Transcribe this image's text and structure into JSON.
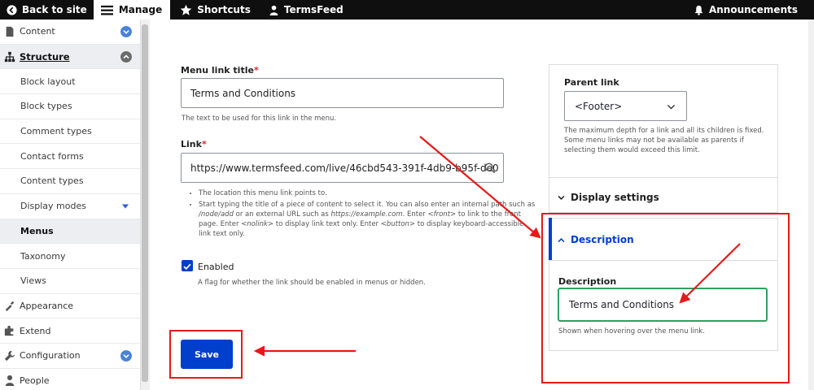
{
  "toolbar": {
    "back": "Back to site",
    "manage": "Manage",
    "shortcuts": "Shortcuts",
    "user": "TermsFeed",
    "announcements": "Announcements"
  },
  "sidebar": {
    "content": "Content",
    "structure": "Structure",
    "sub": {
      "block_layout": "Block layout",
      "block_types": "Block types",
      "comment_types": "Comment types",
      "contact_forms": "Contact forms",
      "content_types": "Content types",
      "display_modes": "Display modes",
      "menus": "Menus",
      "taxonomy": "Taxonomy",
      "views": "Views"
    },
    "appearance": "Appearance",
    "extend": "Extend",
    "configuration": "Configuration",
    "people": "People"
  },
  "form": {
    "menu_link_title_label": "Menu link title",
    "required_mark": "*",
    "menu_link_title_value": "Terms and Conditions",
    "menu_link_title_desc": "The text to be used for this link in the menu.",
    "link_label": "Link",
    "link_value": "https://www.termsfeed.com/live/46cbd543-391f-4db9-b95f-de0",
    "link_desc_1": "The location this menu link points to.",
    "link_desc_2a": "Start typing the title of a piece of content to select it. You can also enter an internal path such as ",
    "link_desc_2b": "/node/add",
    "link_desc_2c": " or an external URL such as ",
    "link_desc_2d": "https://example.com",
    "link_desc_2e": ". Enter ",
    "link_desc_2f": "<front>",
    "link_desc_2g": " to link to the front page. Enter ",
    "link_desc_2h": "<nolink>",
    "link_desc_2i": " to display link text only. Enter ",
    "link_desc_2j": "<button>",
    "link_desc_2k": " to display keyboard-accessible link text only.",
    "enabled_label": "Enabled",
    "enabled_desc": "A flag for whether the link should be enabled in menus or hidden.",
    "save": "Save"
  },
  "panel": {
    "parent_link_label": "Parent link",
    "parent_link_value": "<Footer>",
    "parent_link_desc": "The maximum depth for a link and all its children is fixed. Some menu links may not be available as parents if selecting them would exceed this limit.",
    "display_settings": "Display settings",
    "description_head": "Description",
    "description_label": "Description",
    "description_value": "Terms and Conditions",
    "description_help": "Shown when hovering over the menu link."
  },
  "colors": {
    "accent": "#003ecc",
    "annotation": "#e51a1a",
    "focus_green": "#2ea05f",
    "toolbar_bg": "#0f0f0f"
  }
}
